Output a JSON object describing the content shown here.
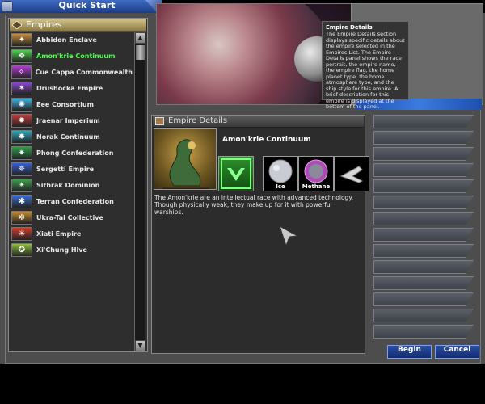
{
  "window": {
    "title": "Quick Start"
  },
  "empires_panel": {
    "header": "Empires",
    "items": [
      {
        "label": "Abbidon Enclave",
        "icon": "abbidon-emblem",
        "color": "#c98a3a"
      },
      {
        "label": "Amon'krie Continuum",
        "icon": "amonkrie-emblem",
        "color": "#4cd34c",
        "selected": true
      },
      {
        "label": "Cue Cappa Commonwealth",
        "icon": "cuecappa-emblem",
        "color": "#b23ad1"
      },
      {
        "label": "Drushocka Empire",
        "icon": "drushocka-emblem",
        "color": "#8c47d6"
      },
      {
        "label": "Eee Consortium",
        "icon": "eee-emblem",
        "color": "#3fb3e6"
      },
      {
        "label": "Jraenar Imperium",
        "icon": "jraenar-emblem",
        "color": "#c33a3a"
      },
      {
        "label": "Norak Continuum",
        "icon": "norak-emblem",
        "color": "#2fa5b8"
      },
      {
        "label": "Phong Confederation",
        "icon": "phong-emblem",
        "color": "#2d9e46"
      },
      {
        "label": "Sergetti Empire",
        "icon": "sergetti-emblem",
        "color": "#3460d8"
      },
      {
        "label": "Sithrak Dominion",
        "icon": "sithrak-emblem",
        "color": "#3ea04a"
      },
      {
        "label": "Terran Confederation",
        "icon": "terran-emblem",
        "color": "#3a6ed6"
      },
      {
        "label": "Ukra-Tal Collective",
        "icon": "ukratal-emblem",
        "color": "#c38a2a"
      },
      {
        "label": "Xiati Empire",
        "icon": "xiati-emblem",
        "color": "#d43a2a"
      },
      {
        "label": "Xi'Chung Hive",
        "icon": "xichung-emblem",
        "color": "#8ac03a"
      }
    ]
  },
  "tooltip": {
    "title": "Empire Details",
    "body": "The Empire Details section displays specific details about the empire selected in the Empires List. The Empire Details panel shows the race portrait, the empire name, the empire flag, the home planet type, the home atmosphere type, and the ship style for this empire. A brief description for this empire is displayed at the bottom of the panel."
  },
  "details": {
    "header": "Empire Details",
    "empire_name": "Amon'krie Continuum",
    "planet_type": "Ice",
    "atmosphere": "Methane",
    "description": "The Amon'krie are an intellectual race with advanced technology. Though physically weak, they make up for it with powerful warships."
  },
  "buttons": {
    "begin": "Begin",
    "cancel": "Cancel"
  },
  "colors": {
    "selected_text": "#4cff4c",
    "button_blue": "#1f3f94"
  }
}
